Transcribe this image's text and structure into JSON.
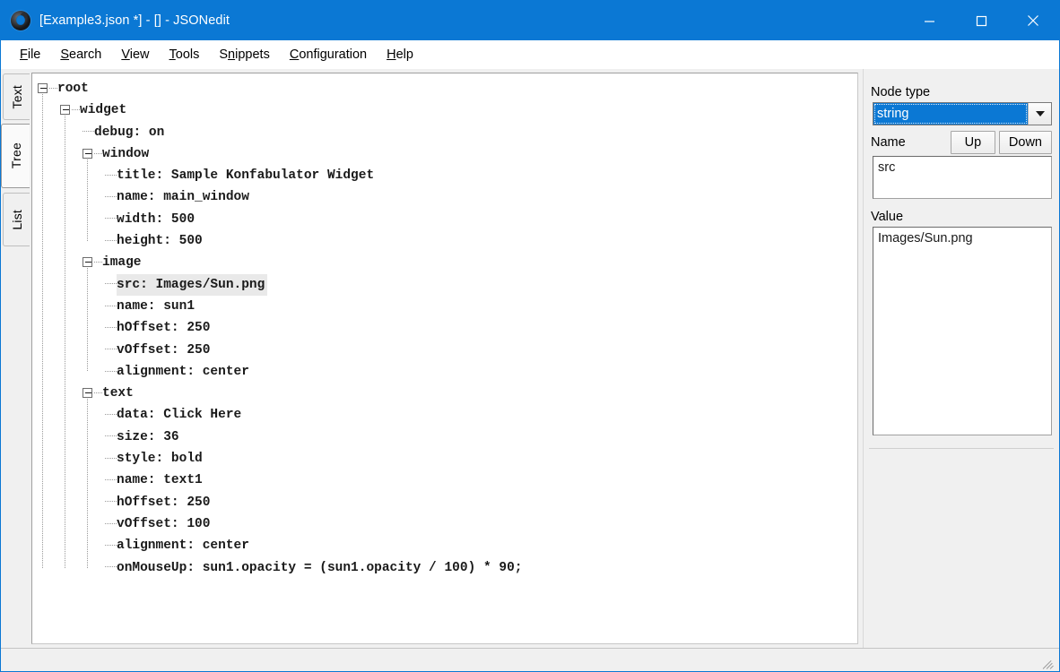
{
  "window": {
    "title": "[Example3.json *] - [] - JSONedit",
    "icon": "app-swirl-icon",
    "controls": {
      "minimize": "minimize-icon",
      "maximize": "maximize-icon",
      "close": "close-icon"
    },
    "titlebar_color": "#0b78d4"
  },
  "menu": {
    "items": [
      {
        "label": "File",
        "accel": "F"
      },
      {
        "label": "Search",
        "accel": "S"
      },
      {
        "label": "View",
        "accel": "V"
      },
      {
        "label": "Tools",
        "accel": "T"
      },
      {
        "label": "Snippets",
        "accel": "n"
      },
      {
        "label": "Configuration",
        "accel": "C"
      },
      {
        "label": "Help",
        "accel": "H"
      }
    ]
  },
  "tabs": {
    "items": [
      {
        "label": "Text",
        "selected": false
      },
      {
        "label": "Tree",
        "selected": true
      },
      {
        "label": "List",
        "selected": false
      }
    ]
  },
  "tree": {
    "selected_row": "src: Images/Sun.png",
    "rows": [
      {
        "depth": 0,
        "kind": "branch",
        "text": "root"
      },
      {
        "depth": 1,
        "kind": "branch",
        "text": "widget"
      },
      {
        "depth": 2,
        "kind": "leaf",
        "text": "debug: on"
      },
      {
        "depth": 2,
        "kind": "branch",
        "text": "window"
      },
      {
        "depth": 3,
        "kind": "leaf",
        "text": "title: Sample Konfabulator Widget"
      },
      {
        "depth": 3,
        "kind": "leaf",
        "text": "name: main_window"
      },
      {
        "depth": 3,
        "kind": "leaf",
        "text": "width: 500"
      },
      {
        "depth": 3,
        "kind": "leaf",
        "text": "height: 500"
      },
      {
        "depth": 2,
        "kind": "branch",
        "text": "image"
      },
      {
        "depth": 3,
        "kind": "leaf",
        "text": "src: Images/Sun.png",
        "selected": true
      },
      {
        "depth": 3,
        "kind": "leaf",
        "text": "name: sun1"
      },
      {
        "depth": 3,
        "kind": "leaf",
        "text": "hOffset: 250"
      },
      {
        "depth": 3,
        "kind": "leaf",
        "text": "vOffset: 250"
      },
      {
        "depth": 3,
        "kind": "leaf",
        "text": "alignment: center"
      },
      {
        "depth": 2,
        "kind": "branch",
        "text": "text"
      },
      {
        "depth": 3,
        "kind": "leaf",
        "text": "data: Click Here"
      },
      {
        "depth": 3,
        "kind": "leaf",
        "text": "size: 36"
      },
      {
        "depth": 3,
        "kind": "leaf",
        "text": "style: bold"
      },
      {
        "depth": 3,
        "kind": "leaf",
        "text": "name: text1"
      },
      {
        "depth": 3,
        "kind": "leaf",
        "text": "hOffset: 250"
      },
      {
        "depth": 3,
        "kind": "leaf",
        "text": "vOffset: 100"
      },
      {
        "depth": 3,
        "kind": "leaf",
        "text": "alignment: center"
      },
      {
        "depth": 3,
        "kind": "leaf",
        "text": "onMouseUp: sun1.opacity = (sun1.opacity / 100) * 90;"
      }
    ]
  },
  "properties": {
    "node_type_label": "Node type",
    "node_type_value": "string",
    "node_type_options": [
      "string"
    ],
    "name_label": "Name",
    "up_label": "Up",
    "down_label": "Down",
    "name_value": "src",
    "value_label": "Value",
    "value_value": "Images/Sun.png",
    "selection_color": "#0b78d4"
  },
  "status": {
    "text": ""
  }
}
